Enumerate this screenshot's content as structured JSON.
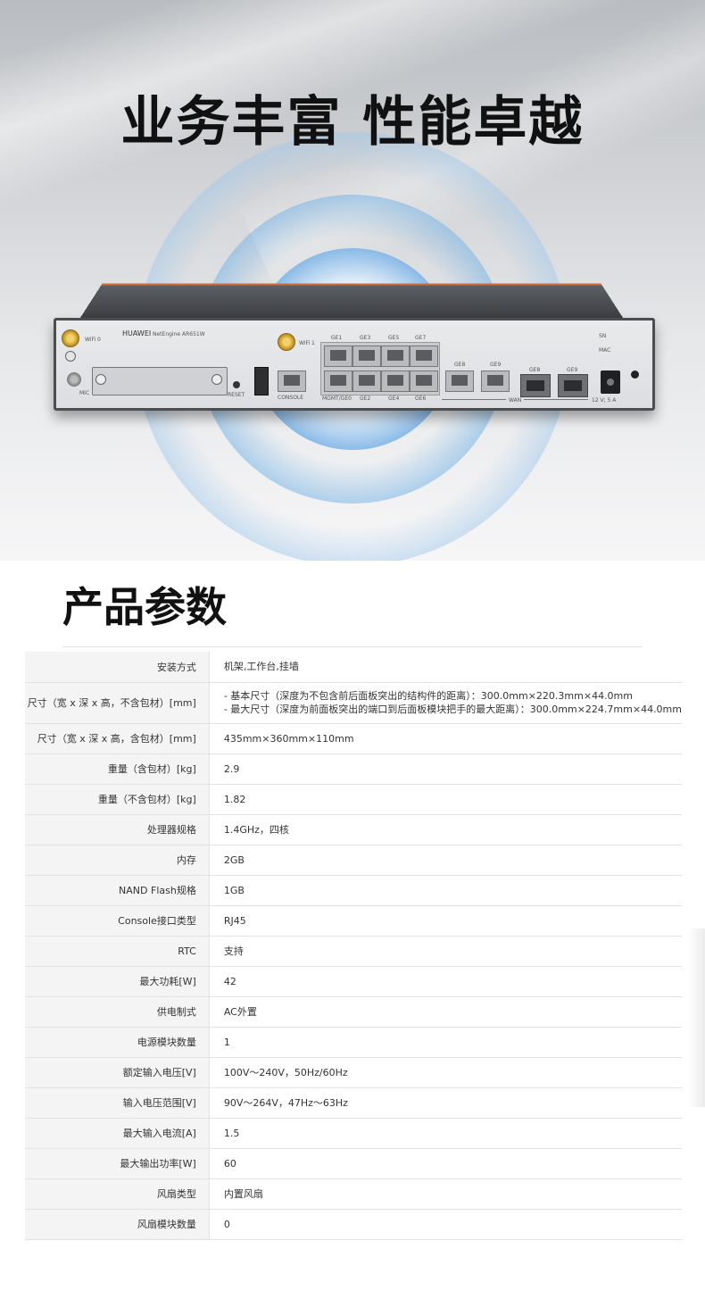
{
  "hero": {
    "title": "业务丰富 性能卓越",
    "device": {
      "brand": "HUAWEI",
      "model": "NetEngine AR651W",
      "labels": {
        "wifi0": "WiFi 0",
        "wifi1": "WiFi 1",
        "mic": "MIC",
        "reset": "RESET",
        "console": "CONSOLE",
        "ge1": "GE1",
        "ge3": "GE3",
        "ge5": "GE5",
        "ge7": "GE7",
        "mgmt": "MGMT/GE0",
        "ge2": "GE2",
        "ge4": "GE4",
        "ge6": "GE6",
        "ge8_top": "GE8",
        "ge9_top": "GE9",
        "ge8_sfp": "GE8",
        "ge9_sfp": "GE9",
        "wan": "WAN",
        "sn": "SN",
        "mac": "MAC",
        "power": "12 V; 5 A"
      }
    }
  },
  "params": {
    "title": "产品参数",
    "rows": [
      {
        "key": "安装方式",
        "value": [
          "机架,工作台,挂墙"
        ]
      },
      {
        "key": "尺寸（宽 x 深 x 高，不含包材）[mm]",
        "value": [
          "- 基本尺寸（深度为不包含前后面板突出的结构件的距离）：300.0mm×220.3mm×44.0mm",
          "- 最大尺寸（深度为前面板突出的端口到后面板模块把手的最大距离）：300.0mm×224.7mm×44.0mm"
        ]
      },
      {
        "key": "尺寸（宽 x 深 x 高，含包材）[mm]",
        "value": [
          "435mm×360mm×110mm"
        ]
      },
      {
        "key": "重量（含包材）[kg]",
        "value": [
          "2.9"
        ]
      },
      {
        "key": "重量（不含包材）[kg]",
        "value": [
          "1.82"
        ]
      },
      {
        "key": "处理器规格",
        "value": [
          "1.4GHz，四核"
        ]
      },
      {
        "key": "内存",
        "value": [
          "2GB"
        ]
      },
      {
        "key": "NAND Flash规格",
        "value": [
          "1GB"
        ]
      },
      {
        "key": "Console接口类型",
        "value": [
          "RJ45"
        ]
      },
      {
        "key": "RTC",
        "value": [
          "支持"
        ]
      },
      {
        "key": "最大功耗[W]",
        "value": [
          "42"
        ]
      },
      {
        "key": "供电制式",
        "value": [
          "AC外置"
        ]
      },
      {
        "key": "电源模块数量",
        "value": [
          "1"
        ]
      },
      {
        "key": "额定输入电压[V]",
        "value": [
          "100V～240V，50Hz/60Hz"
        ]
      },
      {
        "key": "输入电压范围[V]",
        "value": [
          "90V～264V，47Hz～63Hz"
        ]
      },
      {
        "key": "最大输入电流[A]",
        "value": [
          "1.5"
        ]
      },
      {
        "key": "最大输出功率[W]",
        "value": [
          "60"
        ]
      },
      {
        "key": "风扇类型",
        "value": [
          "内置风扇"
        ]
      },
      {
        "key": "风扇模块数量",
        "value": [
          "0"
        ]
      }
    ]
  }
}
